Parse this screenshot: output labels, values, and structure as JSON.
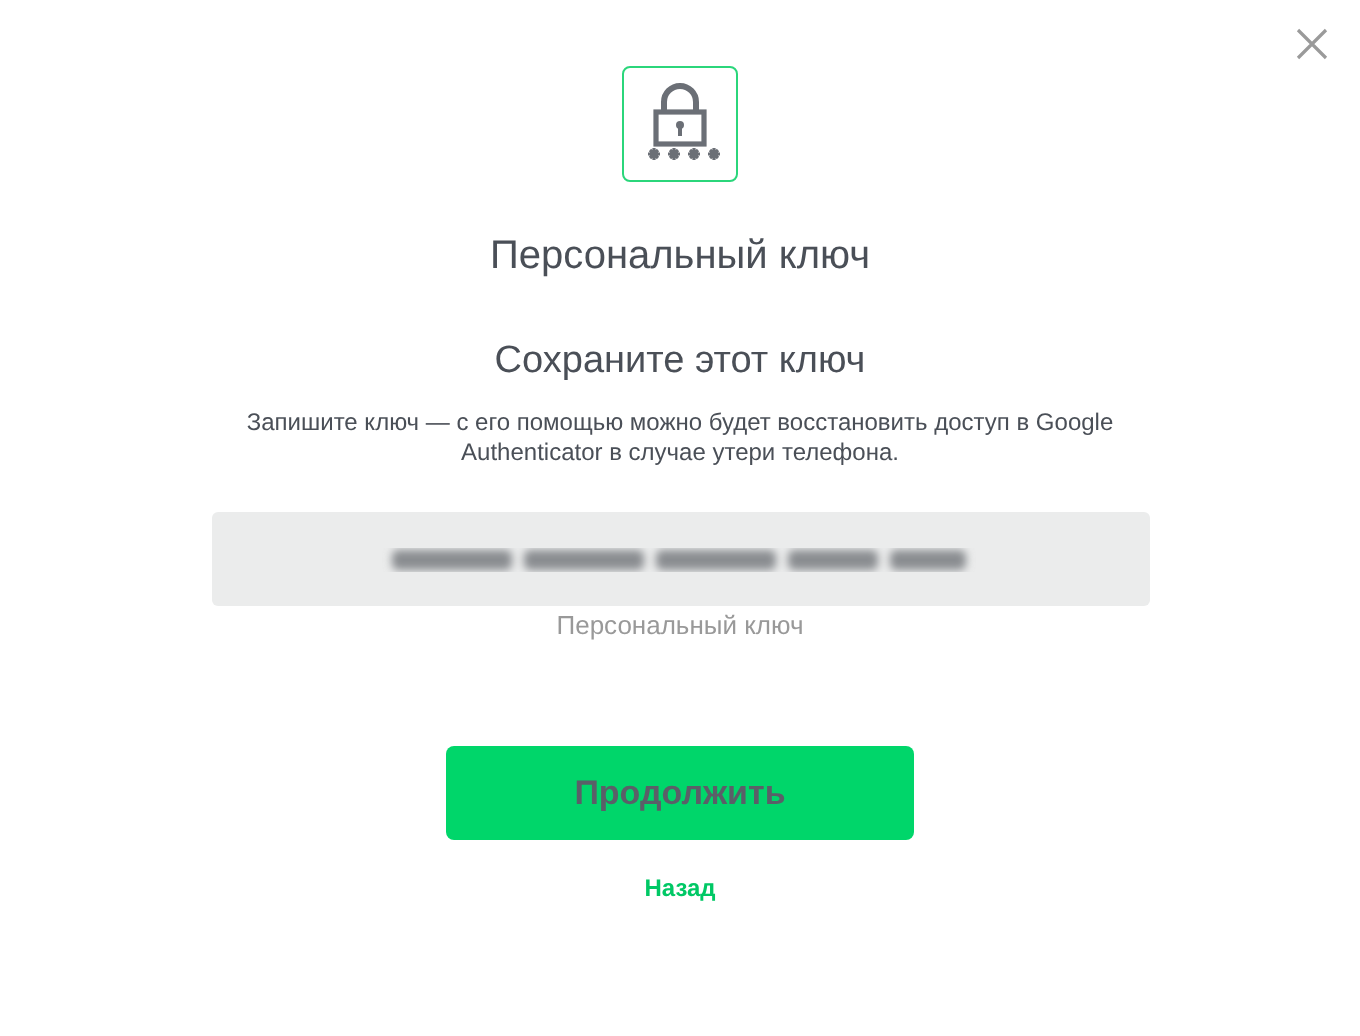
{
  "title": "Персональный ключ",
  "subtitle": "Сохраните этот ключ",
  "description": "Запишите ключ — с его помощью можно будет восстановить доступ в Google Authenticator в случае утери телефона.",
  "key_field": {
    "label": "Персональный ключ"
  },
  "buttons": {
    "primary": "Продолжить",
    "back": "Назад"
  }
}
